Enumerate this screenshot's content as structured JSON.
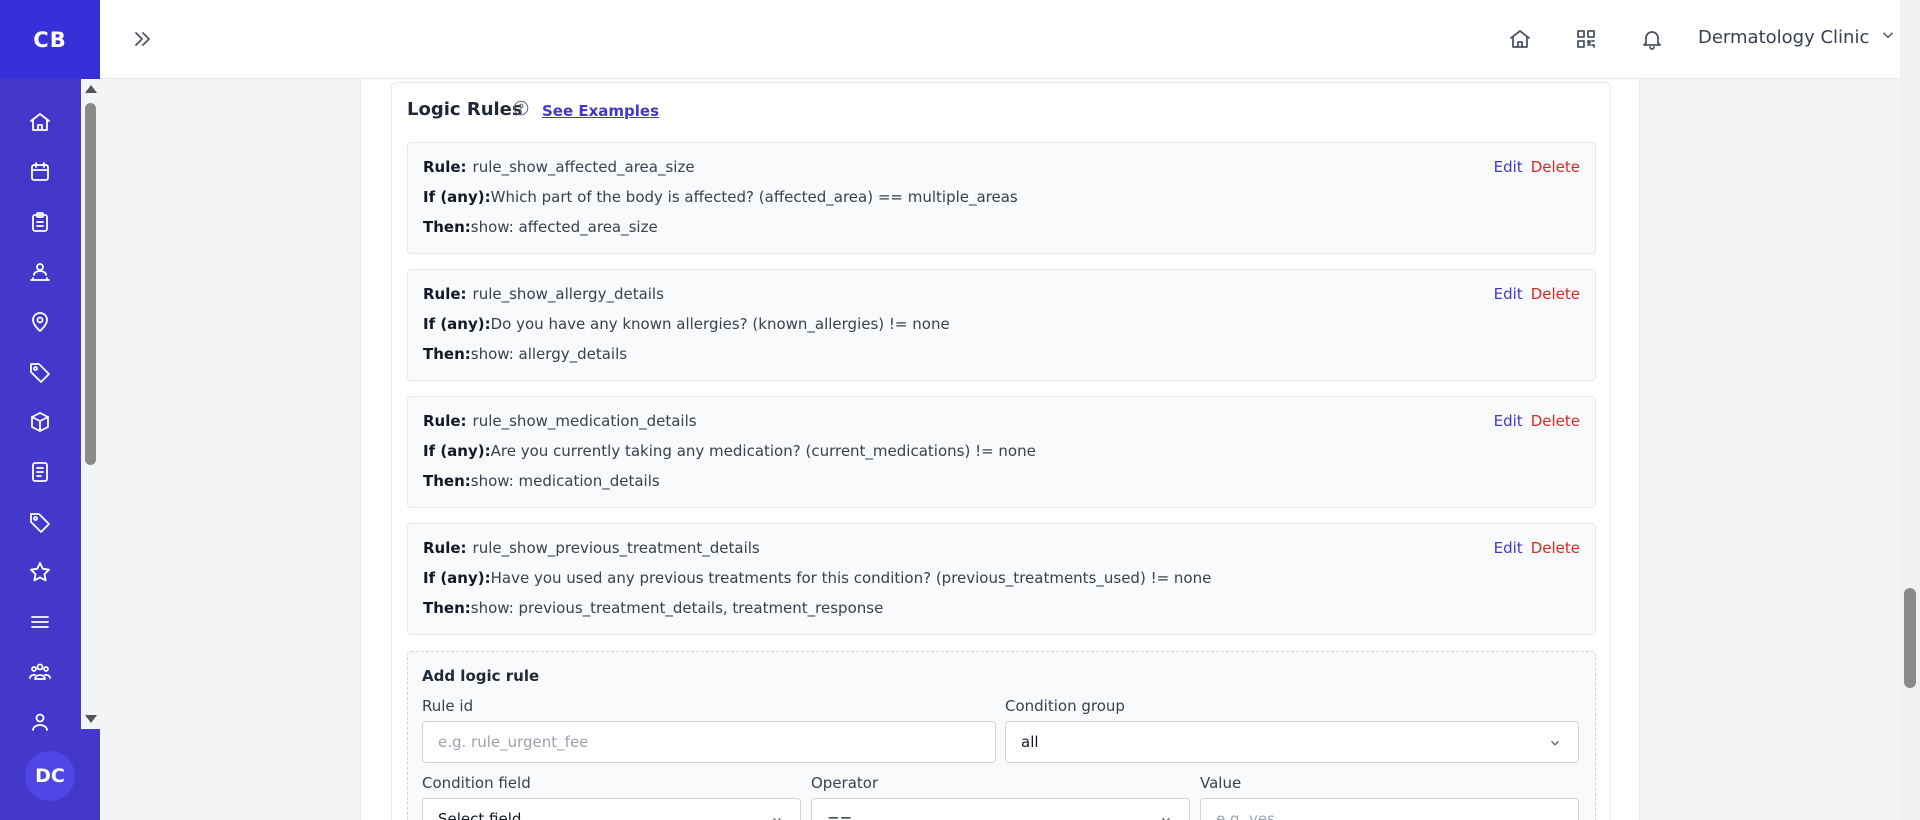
{
  "sidebar": {
    "logo": "CB",
    "user_initials": "DC",
    "icons": [
      "home-icon",
      "calendar-icon",
      "clipboard-icon",
      "team-icon",
      "location-icon",
      "tag-icon",
      "box-icon",
      "document-icon",
      "tag-icon",
      "star-icon",
      "menu-icon",
      "group-icon",
      "user-icon"
    ]
  },
  "header": {
    "clinic_name": "Dermatology Clinic"
  },
  "logic": {
    "title": "Logic Rules",
    "see_examples": "See Examples",
    "rule_label": "Rule:",
    "if_label": "If (any):",
    "then_label": "Then:",
    "edit_label": "Edit",
    "delete_label": "Delete",
    "rules": [
      {
        "id": "rule_show_affected_area_size",
        "condition": "Which part of the body is affected? (affected_area) == multiple_areas",
        "action": "show: affected_area_size"
      },
      {
        "id": "rule_show_allergy_details",
        "condition": "Do you have any known allergies? (known_allergies) != none",
        "action": "show: allergy_details"
      },
      {
        "id": "rule_show_medication_details",
        "condition": "Are you currently taking any medication? (current_medications) != none",
        "action": "show: medication_details"
      },
      {
        "id": "rule_show_previous_treatment_details",
        "condition": "Have you used any previous treatments for this condition? (previous_treatments_used) != none",
        "action": "show: previous_treatment_details, treatment_response"
      }
    ]
  },
  "add_rule": {
    "title": "Add logic rule",
    "rule_id_label": "Rule id",
    "rule_id_placeholder": "e.g. rule_urgent_fee",
    "condition_group_label": "Condition group",
    "condition_group_value": "all",
    "condition_field_label": "Condition field",
    "condition_field_value": "Select field",
    "operator_label": "Operator",
    "operator_value": "==",
    "value_label": "Value",
    "value_placeholder": "e.g. yes"
  }
}
